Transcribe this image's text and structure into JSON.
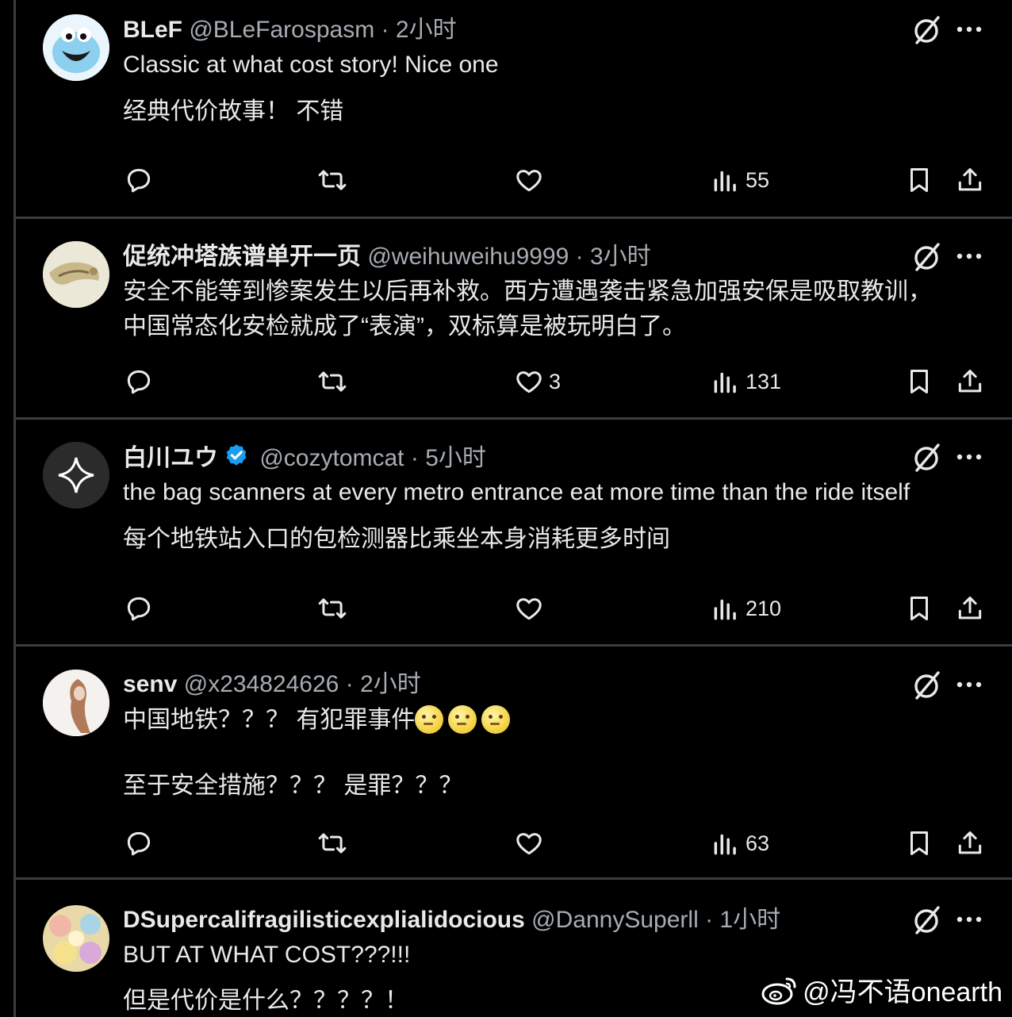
{
  "posts": [
    {
      "name": "BLeF",
      "handle": "@BLeFarospasm",
      "time": "2小时",
      "lines": [
        "Classic at what cost story! Nice one",
        "经典代价故事！ 不错"
      ],
      "likes": "",
      "views": "55"
    },
    {
      "name": "促统冲塔族谱单开一页",
      "handle": "@weihuweihu9999",
      "time": "3小时",
      "lines": [
        "安全不能等到惨案发生以后再补救。西方遭遇袭击紧急加强安保是吸取教训，",
        "中国常态化安检就成了“表演”，双标算是被玩明白了。"
      ],
      "likes": "3",
      "views": "131"
    },
    {
      "name": "白川ユウ",
      "handle": "@cozytomcat",
      "time": "5小时",
      "verified": true,
      "lines": [
        "the bag scanners at every metro entrance eat more time than the ride itself",
        "每个地铁站入口的包检测器比乘坐本身消耗更多时间"
      ],
      "likes": "",
      "views": "210"
    },
    {
      "name": "senv",
      "handle": "@x234824626",
      "time": "2小时",
      "lines": [
        "中国地铁？？？ 有犯罪事件",
        "至于安全措施？？？ 是罪？？？"
      ],
      "emoji": [
        "thinking-face",
        "thinking-face",
        "thinking-face"
      ],
      "likes": "",
      "views": "63"
    },
    {
      "name": "DSupercalifragilisticexplialidocious",
      "handle": "@DannySuperll",
      "time": "1小时",
      "lines": [
        "BUT AT WHAT COST???!!!",
        "但是代价是什么？？？？！"
      ]
    }
  ],
  "separator": " · ",
  "watermark": "@冯不语onearth",
  "colors": {
    "background": "#000000",
    "text": "#e7e9ea",
    "muted": "#a6acb2",
    "verified": "#1d9bf0",
    "divider": "#3a3d40"
  }
}
